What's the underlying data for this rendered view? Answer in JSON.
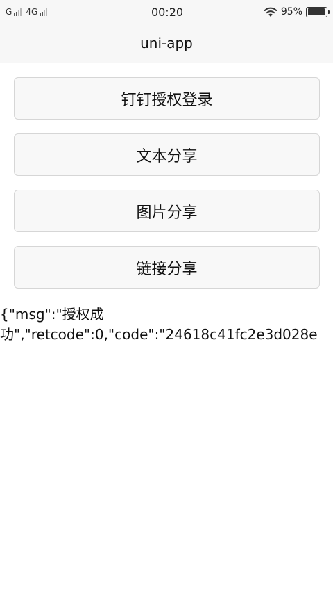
{
  "status_bar": {
    "sim1_label": "G",
    "sim2_label": "4G",
    "time": "00:20",
    "battery_percent": "95%",
    "battery_level": 0.95,
    "icons": [
      "signal-icon",
      "signal-icon",
      "wifi-icon",
      "battery-icon"
    ]
  },
  "nav": {
    "title": "uni-app"
  },
  "buttons": [
    {
      "label": "钉钉授权登录"
    },
    {
      "label": "文本分享"
    },
    {
      "label": "图片分享"
    },
    {
      "label": "链接分享"
    }
  ],
  "result": {
    "line1": "{\"msg\":\"授权成",
    "line2": "功\",\"retcode\":0,\"code\":\"24618c41fc2e3d028e"
  }
}
